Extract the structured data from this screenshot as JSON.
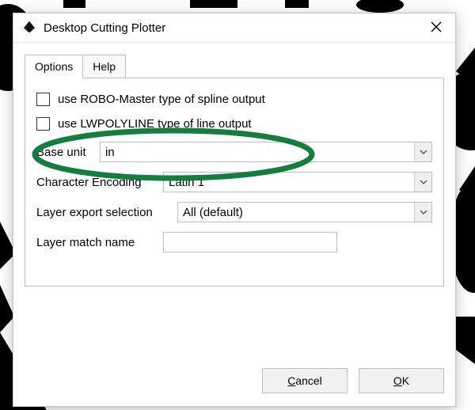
{
  "window": {
    "title": "Desktop Cutting Plotter",
    "icon_name": "inkscape-icon"
  },
  "tabs": {
    "options": "Options",
    "help": "Help",
    "active": "options"
  },
  "options": {
    "robo_master_label": "use ROBO-Master type of spline output",
    "robo_master_checked": false,
    "lwpolyline_label": "use LWPOLYLINE type of line output",
    "lwpolyline_checked": false,
    "base_unit_label": "Base unit",
    "base_unit_value": "in",
    "char_encoding_label": "Character Encoding",
    "char_encoding_value": "Latin 1",
    "layer_export_label": "Layer export selection",
    "layer_export_value": "All (default)",
    "layer_match_label": "Layer match name",
    "layer_match_value": ""
  },
  "footer": {
    "cancel_label": "Cancel",
    "ok_label": "OK"
  },
  "annotation": {
    "color": "#147d3f",
    "target": "base_unit_row"
  }
}
